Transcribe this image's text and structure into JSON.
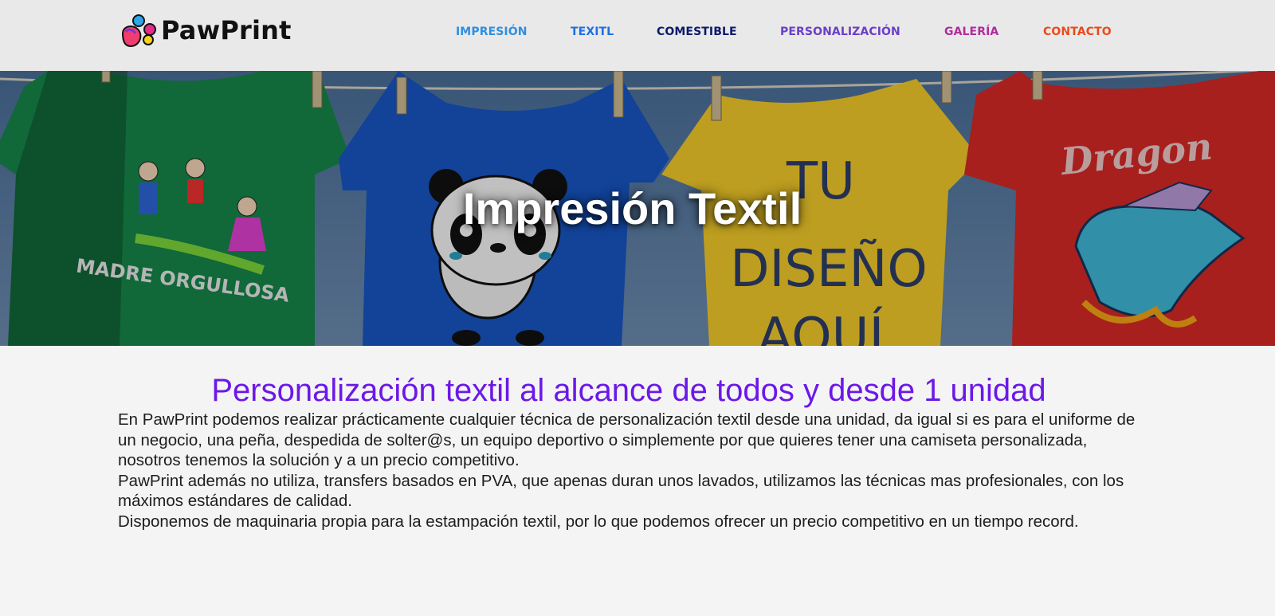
{
  "header": {
    "logo_text": "PawPrint",
    "nav": [
      {
        "label": "IMPRESIÓN",
        "color": "#2f8fe0"
      },
      {
        "label": "TEXITL",
        "color": "#1f6fe0"
      },
      {
        "label": "COMESTIBLE",
        "color": "#0b1a6b"
      },
      {
        "label": "PERSONALIZACIÓN",
        "color": "#6a3fc8"
      },
      {
        "label": "GALERÍA",
        "color": "#b12c9b"
      },
      {
        "label": "CONTACTO",
        "color": "#ea4a1a"
      }
    ]
  },
  "hero": {
    "title": "Impresión Textil",
    "shirt_texts": {
      "green": "MADRE ORGULLOSA",
      "yellow_line1": "TU",
      "yellow_line2": "DISEÑO",
      "yellow_line3": "AQUÍ",
      "red": "Dragon"
    }
  },
  "content": {
    "heading": "Personalización textil al alcance de todos y desde 1 unidad",
    "paragraphs": [
      "En PawPrint podemos realizar prácticamente cualquier técnica de personalización textil desde una unidad, da igual si es para el uniforme de un negocio, una peña, despedida de solter@s, un equipo deportivo o simplemente por que quieres tener una camiseta personalizada, nosotros tenemos la solución y a un precio competitivo.",
      "PawPrint además no utiliza, transfers basados en PVA, que apenas duran unos lavados, utilizamos las técnicas mas profesionales, con los máximos estándares de calidad.",
      "Disponemos de maquinaria propia para la estampación textil, por lo que podemos ofrecer un precio competitivo en un tiempo record."
    ]
  },
  "colors": {
    "heading_purple": "#6b18e8",
    "shirt_green": "#16864a",
    "shirt_blue": "#1856c4",
    "shirt_yellow": "#f2cb2a",
    "shirt_red": "#d72a26"
  }
}
